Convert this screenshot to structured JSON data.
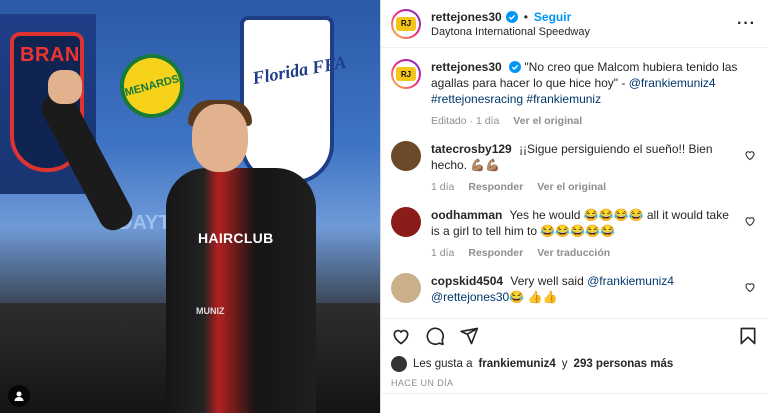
{
  "post": {
    "photo_alt": "Piloto saludando en Daytona International Speedway",
    "banner_brand": "BRAN",
    "menards": "MENARDS",
    "ffa": "Florida FFA",
    "daytona": "DAYTONA",
    "suit_sponsor": "HAIRCLUB",
    "belt": "MUNIZ"
  },
  "header": {
    "username": "rettejones30",
    "follow_label": "Seguir",
    "location": "Daytona International Speedway",
    "more_icon": "more-icon"
  },
  "caption": {
    "username": "rettejones30",
    "text": "\"No creo que Malcom hubiera tenido las agallas para hacer lo que hice hoy\" - ",
    "mention": "@frankiemuniz4",
    "hashtags": "#rettejonesracing #frankiemuniz",
    "meta_edited": "Editado · 1 día",
    "meta_original": "Ver el original"
  },
  "comments": [
    {
      "username": "tatecrosby129",
      "text": "¡¡Sigue persiguiendo el sueño!! Bien hecho. 💪🏽💪🏽",
      "time": "1 día",
      "reply": "Responder",
      "extra": "Ver el original",
      "avatar_color": "#6b4a2a"
    },
    {
      "username": "oodhamman",
      "text": "Yes he would 😂😂😂😂 all it would take is a girl to tell him to 😂😂😂😂😂",
      "time": "1 día",
      "reply": "Responder",
      "extra": "Ver traducción",
      "avatar_color": "#8a1c1c"
    },
    {
      "username": "copskid4504",
      "text_pre": "Very well said ",
      "mention1": "@frankiemuniz4",
      "mention2": "@rettejones30",
      "text_post": "😂 👍👍",
      "avatar_color": "#c9b08a"
    }
  ],
  "likes": {
    "prefix": "Les gusta a",
    "user": "frankiemuniz4",
    "mid": "y",
    "count": "293 personas más"
  },
  "time_ago": "HACE UN DÍA",
  "colors": {
    "accent": "#0095f6",
    "link": "#00376b",
    "muted": "#8e8e8e"
  }
}
